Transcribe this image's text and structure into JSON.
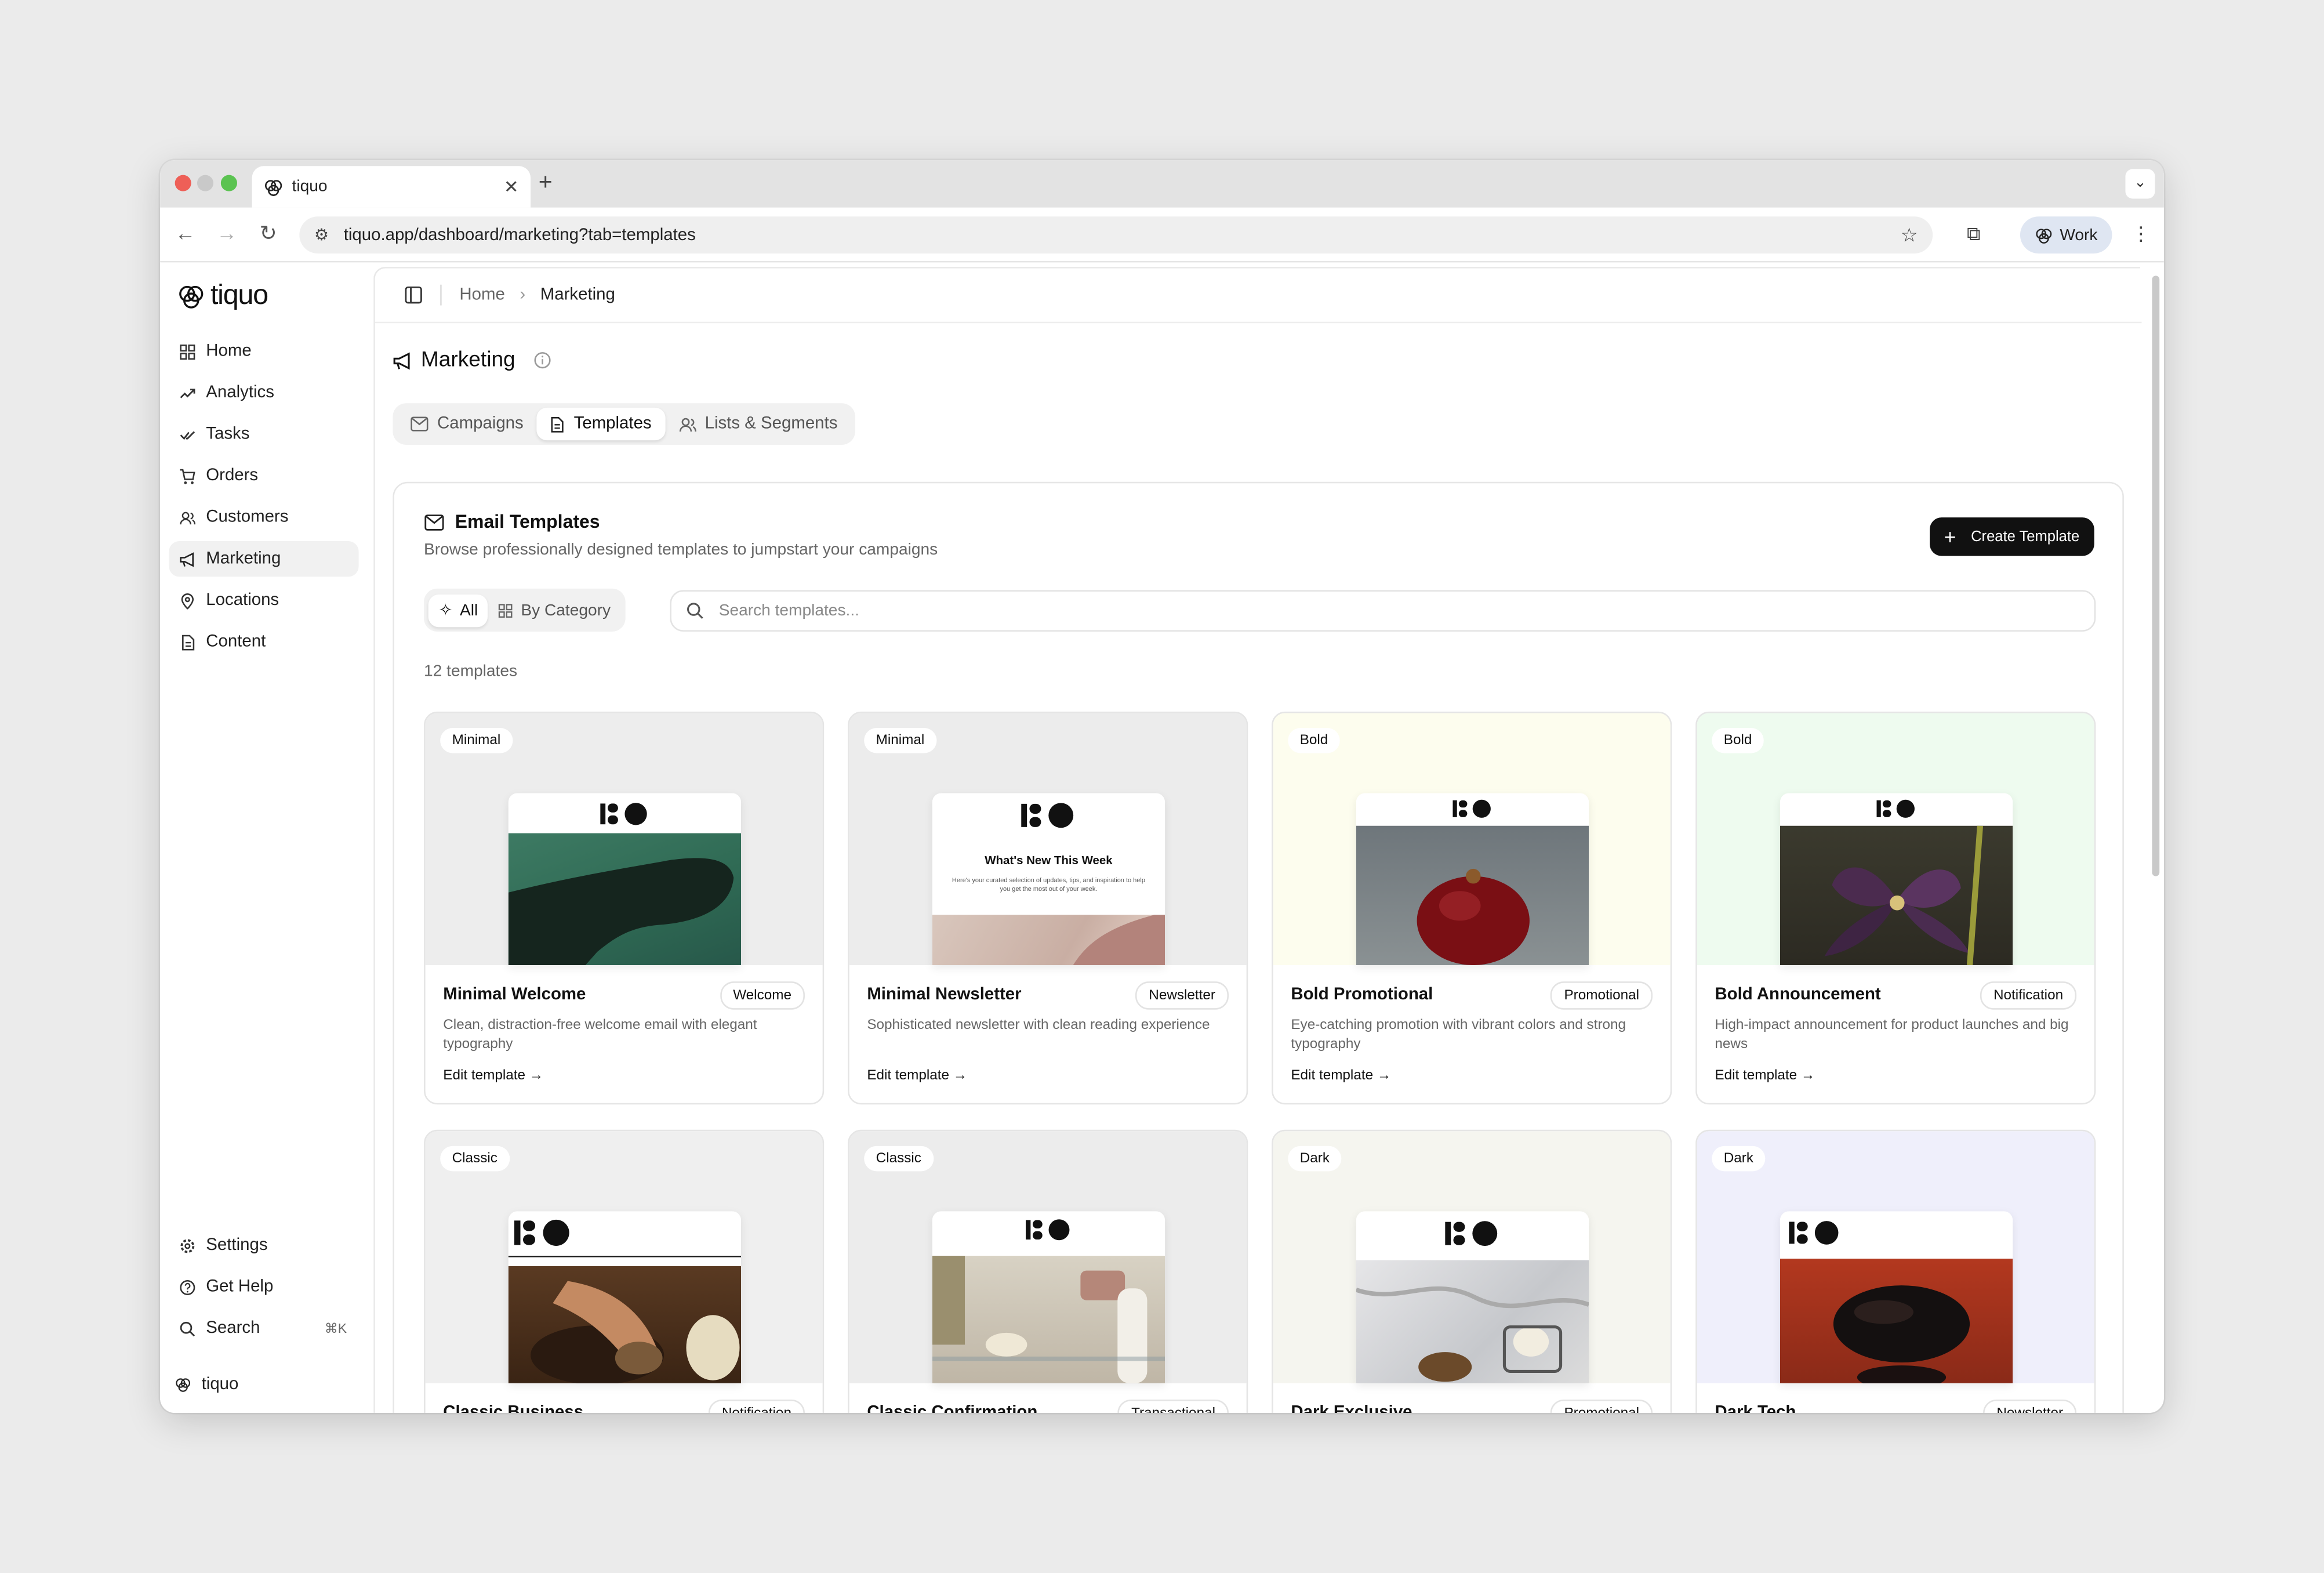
{
  "browser": {
    "tab_title": "tiquo",
    "url": "tiquo.app/dashboard/marketing?tab=templates",
    "profile": "Work"
  },
  "sidebar": {
    "brand": "tiquo",
    "items": [
      {
        "label": "Home",
        "icon": "home-icon"
      },
      {
        "label": "Analytics",
        "icon": "trend-icon"
      },
      {
        "label": "Tasks",
        "icon": "check-icon"
      },
      {
        "label": "Orders",
        "icon": "cart-icon"
      },
      {
        "label": "Customers",
        "icon": "users-icon"
      },
      {
        "label": "Marketing",
        "icon": "megaphone-icon"
      },
      {
        "label": "Locations",
        "icon": "pin-icon"
      },
      {
        "label": "Content",
        "icon": "file-icon"
      }
    ],
    "bottom": [
      {
        "label": "Settings",
        "icon": "gear-icon"
      },
      {
        "label": "Get Help",
        "icon": "help-icon"
      },
      {
        "label": "Search",
        "icon": "search-icon",
        "shortcut": "⌘K"
      }
    ],
    "workspace": "tiquo"
  },
  "breadcrumb": {
    "home": "Home",
    "current": "Marketing"
  },
  "page": {
    "title": "Marketing",
    "tabs": [
      "Campaigns",
      "Templates",
      "Lists & Segments"
    ],
    "active_tab": "Templates"
  },
  "templates_panel": {
    "title": "Email Templates",
    "description": "Browse professionally designed templates to jumpstart your campaigns",
    "create_label": "Create Template",
    "filters": [
      "All",
      "By Category"
    ],
    "search_placeholder": "Search templates...",
    "count_text": "12 templates",
    "edit_label": "Edit template"
  },
  "cards": [
    {
      "style": "Minimal",
      "name": "Minimal Welcome",
      "tag": "Welcome",
      "desc": "Clean, distraction-free welcome email with elegant typography"
    },
    {
      "style": "Minimal",
      "name": "Minimal Newsletter",
      "tag": "Newsletter",
      "desc": "Sophisticated newsletter with clean reading experience",
      "mock_heading": "What's New This Week",
      "mock_body": "Here's your curated selection of updates, tips, and inspiration to help you get the most out of your week."
    },
    {
      "style": "Bold",
      "name": "Bold Promotional",
      "tag": "Promotional",
      "desc": "Eye-catching promotion with vibrant colors and strong typography"
    },
    {
      "style": "Bold",
      "name": "Bold Announcement",
      "tag": "Notification",
      "desc": "High-impact announcement for product launches and big news"
    },
    {
      "style": "Classic",
      "name": "Classic Business",
      "tag": "Notification",
      "desc": ""
    },
    {
      "style": "Classic",
      "name": "Classic Confirmation",
      "tag": "Transactional",
      "desc": ""
    },
    {
      "style": "Dark",
      "name": "Dark Exclusive",
      "tag": "Promotional",
      "desc": ""
    },
    {
      "style": "Dark",
      "name": "Dark Tech",
      "tag": "Newsletter",
      "desc": ""
    }
  ],
  "colors": {
    "accent": "#111111",
    "sidebar_active": "#f1f1f1",
    "page_bg": "#ebebeb"
  }
}
